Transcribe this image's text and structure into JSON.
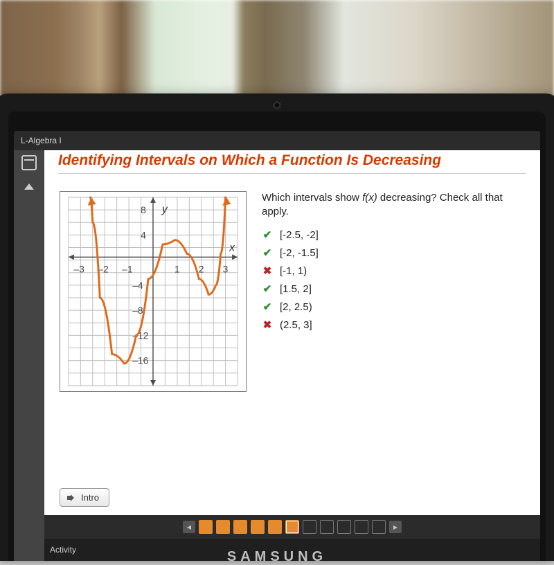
{
  "course_label": "L-Algebra I",
  "lesson_title": "Identifying Intervals on Which a Function Is Decreasing",
  "question": {
    "prompt_a": "Which intervals show ",
    "fx": "f(x)",
    "prompt_b": " decreasing? Check all that apply."
  },
  "options": [
    {
      "text": "[-2.5, -2]",
      "correct": true
    },
    {
      "text": "[-2, -1.5]",
      "correct": true
    },
    {
      "text": "[-1, 1)",
      "correct": false
    },
    {
      "text": "[1.5, 2]",
      "correct": true
    },
    {
      "text": "[2, 2.5)",
      "correct": true
    },
    {
      "text": "(2.5, 3]",
      "correct": false
    }
  ],
  "intro_label": "Intro",
  "activity_label": "Activity",
  "brand_text": "SAMSUNG",
  "chart_data": {
    "type": "line",
    "xlabel": "x",
    "ylabel": "y",
    "xlim": [
      -3.5,
      3.5
    ],
    "ylim": [
      -20,
      10
    ],
    "x_ticks": [
      -3,
      -2,
      -1,
      1,
      2,
      3
    ],
    "y_ticks": [
      8,
      4,
      -4,
      -8,
      -12,
      -16
    ],
    "grid": true,
    "series": [
      {
        "name": "f(x)",
        "color": "#e06a1a",
        "points": [
          {
            "x": -2.6,
            "y": 10
          },
          {
            "x": -2.5,
            "y": 6
          },
          {
            "x": -2.2,
            "y": -6
          },
          {
            "x": -1.7,
            "y": -15
          },
          {
            "x": -1.2,
            "y": -16.5
          },
          {
            "x": -0.7,
            "y": -12
          },
          {
            "x": -0.2,
            "y": -3
          },
          {
            "x": 0.4,
            "y": 2.5
          },
          {
            "x": 0.9,
            "y": 3.2
          },
          {
            "x": 1.4,
            "y": 1
          },
          {
            "x": 1.9,
            "y": -3
          },
          {
            "x": 2.3,
            "y": -5.5
          },
          {
            "x": 2.6,
            "y": -4
          },
          {
            "x": 2.8,
            "y": 1
          },
          {
            "x": 3.0,
            "y": 10
          }
        ]
      }
    ]
  },
  "pager": {
    "total": 11,
    "current": 6,
    "completed_through": 6
  }
}
